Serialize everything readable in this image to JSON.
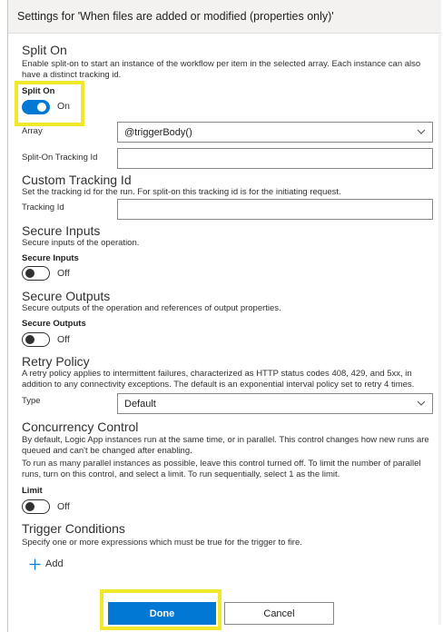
{
  "header": {
    "title": "Settings for 'When files are added or modified (properties only)'"
  },
  "split_on": {
    "heading": "Split On",
    "description": "Enable split-on to start an instance of the workflow per item in the selected array. Each instance can also have a distinct tracking id.",
    "toggle_label": "Split On",
    "toggle_state": "On",
    "array_label": "Array",
    "array_value": "@triggerBody()",
    "tracking_label": "Split-On Tracking Id",
    "tracking_value": ""
  },
  "custom_tracking": {
    "heading": "Custom Tracking Id",
    "description": "Set the tracking id for the run. For split-on this tracking id is for the initiating request.",
    "field_label": "Tracking Id",
    "field_value": ""
  },
  "secure_inputs": {
    "heading": "Secure Inputs",
    "description": "Secure inputs of the operation.",
    "toggle_label": "Secure Inputs",
    "toggle_state": "Off"
  },
  "secure_outputs": {
    "heading": "Secure Outputs",
    "description": "Secure outputs of the operation and references of output properties.",
    "toggle_label": "Secure Outputs",
    "toggle_state": "Off"
  },
  "retry": {
    "heading": "Retry Policy",
    "description_line1": "A retry policy applies to intermittent failures, characterized as HTTP status codes 408, 429, and 5xx, in",
    "description_line2": "addition to any connectivity exceptions. The default is an exponential interval policy set to retry 4 times.",
    "type_label": "Type",
    "type_value": "Default"
  },
  "concurrency": {
    "heading": "Concurrency Control",
    "description1_line1": "By default, Logic App instances run at the same time, or in parallel. This control changes how new runs are",
    "description1_line2": "queued and can't be changed after enabling.",
    "description2_line1": "To run as many parallel instances as possible, leave this control turned off. To limit the number of parallel",
    "description2_line2": "runs, turn on this control, and select a limit. To run sequentially, select 1 as the limit.",
    "toggle_label": "Limit",
    "toggle_state": "Off"
  },
  "trigger_conditions": {
    "heading": "Trigger Conditions",
    "description": "Specify one or more expressions which must be true for the trigger to fire.",
    "add_label": "Add"
  },
  "footer": {
    "done_label": "Done",
    "cancel_label": "Cancel"
  },
  "colors": {
    "accent": "#0078d4",
    "highlight": "#f2e82b"
  },
  "icons": {
    "chevron": "chevron-down-icon",
    "add": "plus-icon"
  }
}
